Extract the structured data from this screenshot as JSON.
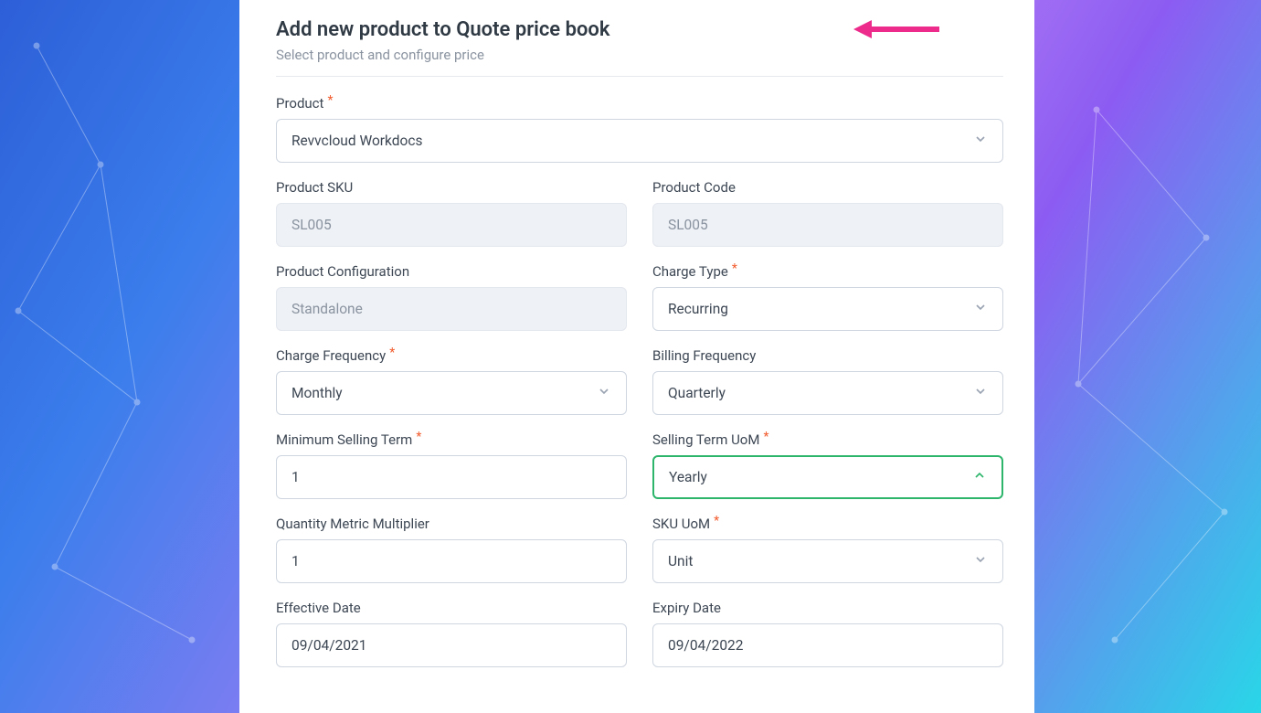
{
  "header": {
    "title": "Add new product to Quote price book",
    "subtitle": "Select product and configure price"
  },
  "fields": {
    "product": {
      "label": "Product",
      "value": "Revvcloud Workdocs",
      "required": true
    },
    "product_sku": {
      "label": "Product SKU",
      "value": "SL005"
    },
    "product_code": {
      "label": "Product Code",
      "value": "SL005"
    },
    "product_config": {
      "label": "Product Configuration",
      "value": "Standalone"
    },
    "charge_type": {
      "label": "Charge Type",
      "value": "Recurring",
      "required": true
    },
    "charge_frequency": {
      "label": "Charge Frequency",
      "value": "Monthly",
      "required": true
    },
    "billing_frequency": {
      "label": "Billing Frequency",
      "value": "Quarterly"
    },
    "min_selling_term": {
      "label": "Minimum Selling Term",
      "value": "1",
      "required": true
    },
    "selling_term_uom": {
      "label": "Selling Term UoM",
      "value": "Yearly",
      "required": true
    },
    "qty_metric_multiplier": {
      "label": "Quantity Metric Multiplier",
      "value": "1"
    },
    "sku_uom": {
      "label": "SKU UoM",
      "value": "Unit",
      "required": true
    },
    "effective_date": {
      "label": "Effective Date",
      "value": "09/04/2021"
    },
    "expiry_date": {
      "label": "Expiry Date",
      "value": "09/04/2022"
    }
  },
  "req_marker": "*"
}
